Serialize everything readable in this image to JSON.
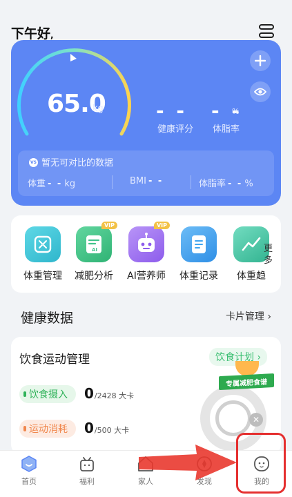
{
  "header": {
    "greeting": "下午好",
    "greeting_suffix": ","
  },
  "weight_card": {
    "weight": "65.0",
    "unit": "kg",
    "health_score": {
      "value": "- -",
      "label": "健康评分"
    },
    "body_fat": {
      "value": "- -",
      "unit": "%",
      "label": "体脂率"
    },
    "compare": {
      "badge": "VS",
      "message": "暂无可对比的数据",
      "weight_label": "体重",
      "weight_value": "- -",
      "weight_unit": "kg",
      "bmi_label": "BMI",
      "bmi_value": "- -",
      "fat_label": "体脂率",
      "fat_value": "- -",
      "fat_unit": "%"
    }
  },
  "shortcuts": {
    "vip_tag": "VIP",
    "more_label": "更多",
    "items": [
      {
        "label": "体重管理",
        "icon": "scale-icon",
        "color": "#3cc6d6",
        "vip": false
      },
      {
        "label": "减肥分析",
        "icon": "document-ai-icon",
        "color": "#43c48c",
        "vip": true
      },
      {
        "label": "AI营养师",
        "icon": "robot-icon",
        "color": "#a077f2",
        "vip": true
      },
      {
        "label": "体重记录",
        "icon": "notebook-icon",
        "color": "#3fa5f0",
        "vip": false
      },
      {
        "label": "体重趋",
        "icon": "trend-icon",
        "color": "#49c9a8",
        "vip": false
      }
    ]
  },
  "health_section": {
    "title": "健康数据",
    "manage_label": "卡片管理"
  },
  "diet_card": {
    "title": "饮食运动管理",
    "plan_label": "饮食计划",
    "intake": {
      "label": "饮食摄入",
      "value": "0",
      "target": "/2428 大卡"
    },
    "burn": {
      "label": "运动消耗",
      "value": "0",
      "target": "/500 大卡"
    },
    "promo_label": "专属减肥食谱"
  },
  "bottom_nav": {
    "items": [
      {
        "label": "首页",
        "icon": "home-hexagon-icon"
      },
      {
        "label": "福利",
        "icon": "gift-icon"
      },
      {
        "label": "家人",
        "icon": "family-house-icon"
      },
      {
        "label": "发现",
        "icon": "discover-icon"
      },
      {
        "label": "我的",
        "icon": "profile-face-icon"
      }
    ]
  },
  "colors": {
    "card_blue": "#5c86f4",
    "accent_green": "#2fb259",
    "accent_orange": "#f0864b",
    "highlight_red": "#e52f2f"
  }
}
